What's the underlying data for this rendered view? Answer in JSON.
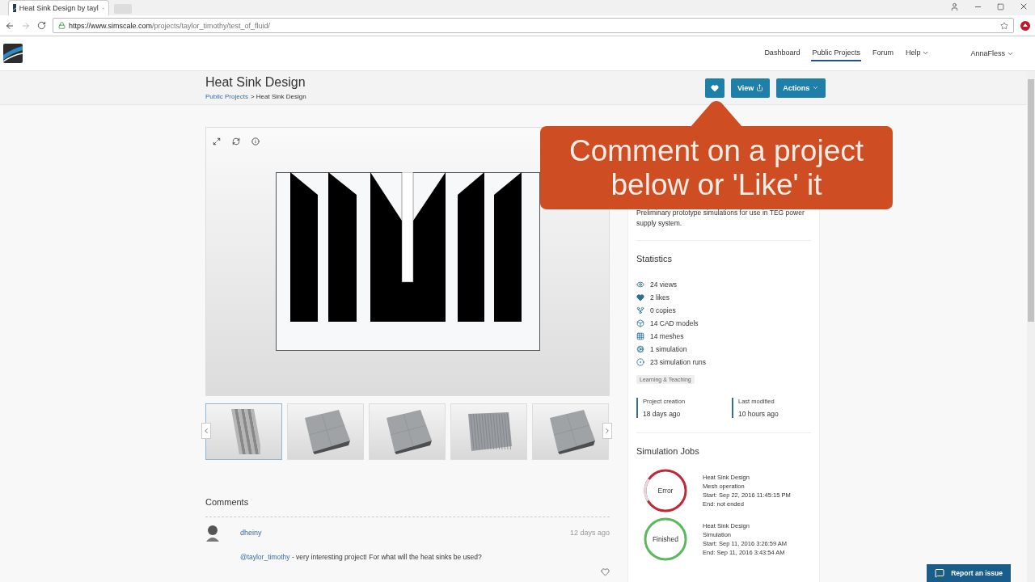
{
  "browser": {
    "tab_title": "Heat Sink Design by tayl",
    "url_host": "https://www.simscale.com",
    "url_path": "/projects/taylor_timothy/test_of_fluid/"
  },
  "nav": {
    "items": [
      {
        "label": "Dashboard",
        "selected": false,
        "dropdown": false
      },
      {
        "label": "Public Projects",
        "selected": true,
        "dropdown": false
      },
      {
        "label": "Forum",
        "selected": false,
        "dropdown": false
      },
      {
        "label": "Help",
        "selected": false,
        "dropdown": true
      }
    ],
    "user": "AnnaFless"
  },
  "header": {
    "title": "Heat Sink Design",
    "breadcrumb_link": "Public Projects",
    "breadcrumb_current": "> Heat Sink Design",
    "view_button": "View",
    "actions_button": "Actions"
  },
  "thumbnails": [
    {
      "kind": "fins",
      "selected": true
    },
    {
      "kind": "block",
      "selected": false
    },
    {
      "kind": "block",
      "selected": false
    },
    {
      "kind": "ribbed",
      "selected": false
    },
    {
      "kind": "block",
      "selected": false
    }
  ],
  "callout": "Comment on a project below or 'Like' it",
  "card": {
    "description": "Preliminary prototype simulations for use in TEG power supply system.",
    "statistics_title": "Statistics",
    "statistics": [
      {
        "kind": "views",
        "text": "24 views"
      },
      {
        "kind": "likes",
        "text": "2 likes"
      },
      {
        "kind": "copies",
        "text": "0 copies"
      },
      {
        "kind": "cad",
        "text": "14 CAD models"
      },
      {
        "kind": "meshes",
        "text": "14 meshes"
      },
      {
        "kind": "simulations",
        "text": "1 simulation"
      },
      {
        "kind": "runs",
        "text": "23 simulation runs"
      }
    ],
    "tag": "Learning & Teaching",
    "dates": [
      {
        "label": "Project creation",
        "value": "18 days ago"
      },
      {
        "label": "Last modified",
        "value": "10 hours ago"
      }
    ],
    "jobs_title": "Simulation Jobs",
    "jobs": [
      {
        "status": "Error",
        "kind": "error",
        "color": "#c0283a",
        "name": "Heat Sink Design",
        "type": "Mesh operation",
        "start": "Start: Sep 22, 2016 11:45:15 PM",
        "end": "End: not ended"
      },
      {
        "status": "Finished",
        "kind": "finished",
        "color": "#5cb85c",
        "name": "Heat Sink Design",
        "type": "Simulation",
        "start": "Start: Sep 11, 2016 3:26:59 AM",
        "end": "End: Sep 11, 2016 3:43:54 AM"
      }
    ]
  },
  "comments": {
    "title": "Comments",
    "items": [
      {
        "author": "dheiny",
        "time": "12 days ago",
        "mention": "@taylor_timothy",
        "text": " - very interesting project! For what will the heat sinks be used?"
      }
    ]
  },
  "report_button": "Report an issue"
}
